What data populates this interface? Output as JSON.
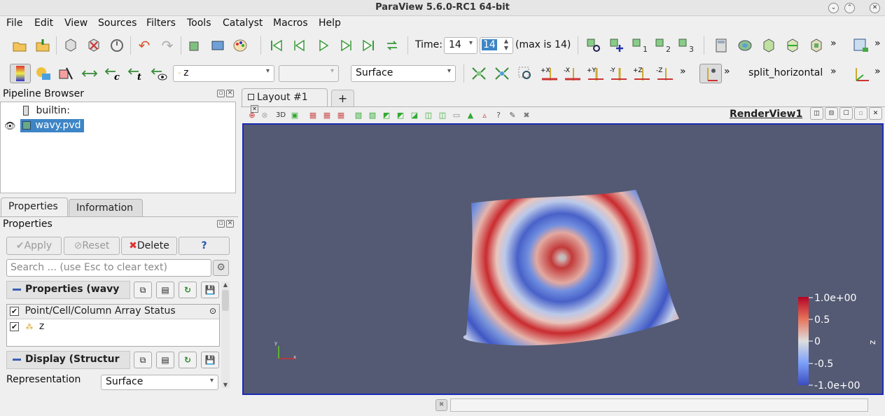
{
  "window": {
    "title": "ParaView 5.6.0-RC1 64-bit"
  },
  "menu": [
    "File",
    "Edit",
    "View",
    "Sources",
    "Filters",
    "Tools",
    "Catalyst",
    "Macros",
    "Help"
  ],
  "time": {
    "label": "Time:",
    "value": "14",
    "spin_value": "14",
    "max_text": "(max is 14)"
  },
  "toolbar2": {
    "color_by_value": "z",
    "component_value": "",
    "representation_value": "Surface",
    "layout_label": "split_horizontal",
    "more": "»"
  },
  "pipeline": {
    "title": "Pipeline Browser",
    "items": [
      {
        "label": "builtin:",
        "icon": "server-icon"
      },
      {
        "label": "wavy.pvd",
        "icon": "dataset-icon",
        "selected": true
      }
    ]
  },
  "panel_tabs": [
    "Properties",
    "Information"
  ],
  "properties": {
    "title": "Properties",
    "apply": "Apply",
    "reset": "Reset",
    "delete": "Delete",
    "help": "?",
    "search_placeholder": "Search ... (use Esc to clear text)",
    "section1": "Properties (wavy",
    "array_header": "Point/Cell/Column Array Status",
    "array_item": "z",
    "section2": "Display (Structur",
    "representation_label": "Representation",
    "representation_value": "Surface"
  },
  "layout": {
    "tab_label": "Layout #1",
    "add": "+",
    "view_name": "RenderView1",
    "three_d": "3D"
  },
  "colorbar": {
    "title": "z",
    "ticks": [
      "1.0e+00",
      "0.5",
      "0",
      "-0.5",
      "-1.0e+00"
    ],
    "colors": {
      "high": "#b40426",
      "mid": "#dddddd",
      "low": "#3b4cc0"
    }
  },
  "colors": {
    "view_bg": "#545a73",
    "selection": "#3d85c6",
    "active_border": "#1b2bb6"
  }
}
